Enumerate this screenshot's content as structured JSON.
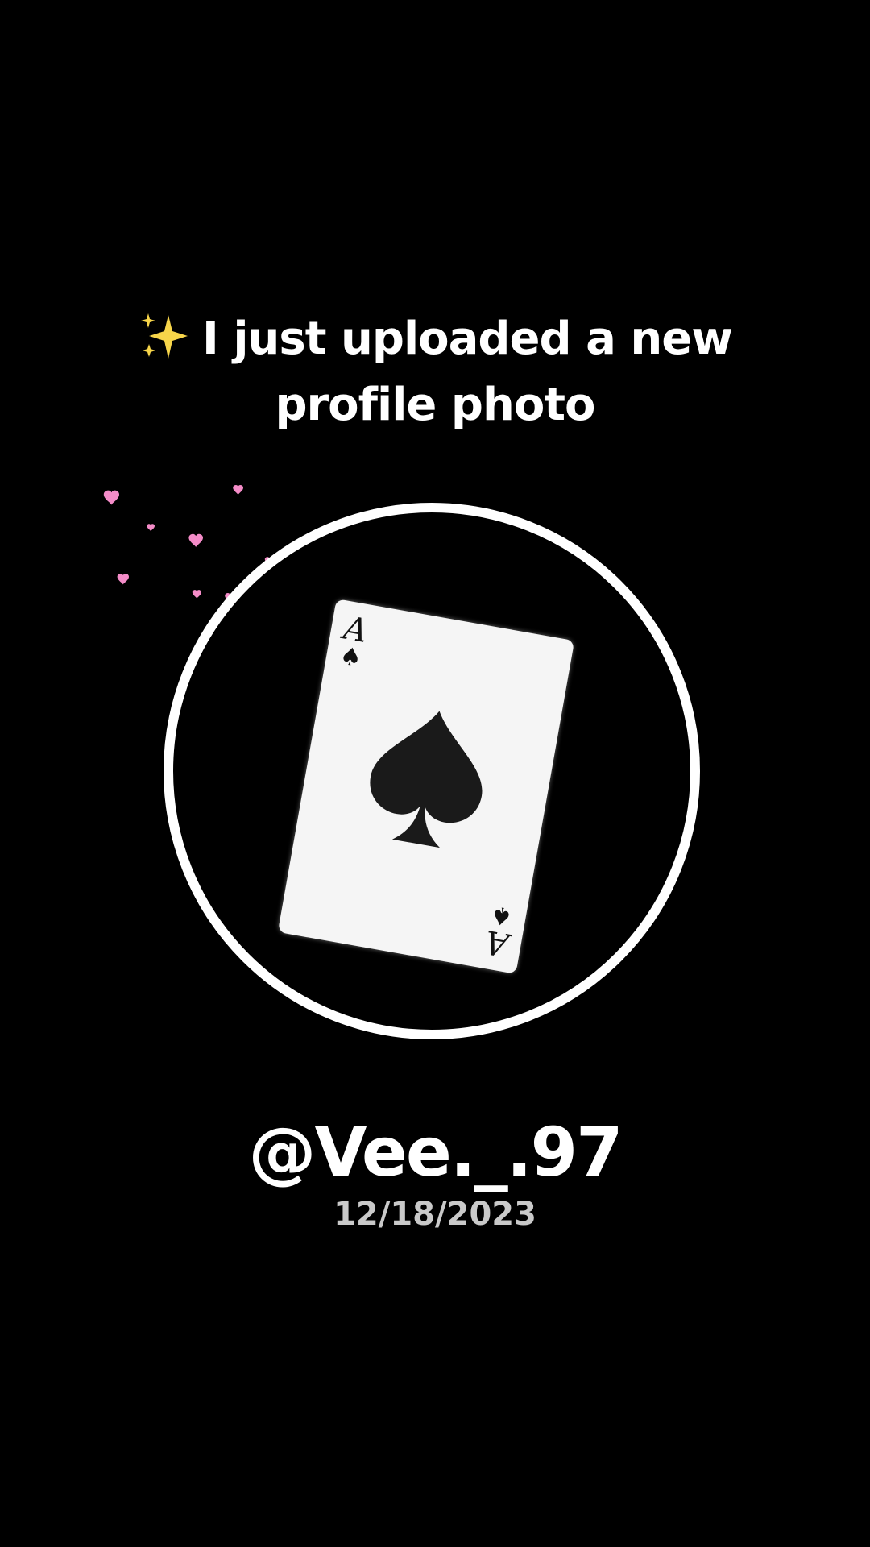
{
  "headline": {
    "icon": "sparkles-icon",
    "line1": "I just uploaded a new",
    "line2": "profile photo"
  },
  "avatar": {
    "card_rank": "A",
    "card_suit": "♠",
    "ring_color": "#ffffff"
  },
  "profile": {
    "username": "@Vee._.97",
    "date": "12/18/2023"
  },
  "colors": {
    "background": "#000000",
    "text": "#ffffff",
    "date_text": "#c9c9c9",
    "hearts": "#f48cc8",
    "sparkle": "#f7d54a"
  }
}
